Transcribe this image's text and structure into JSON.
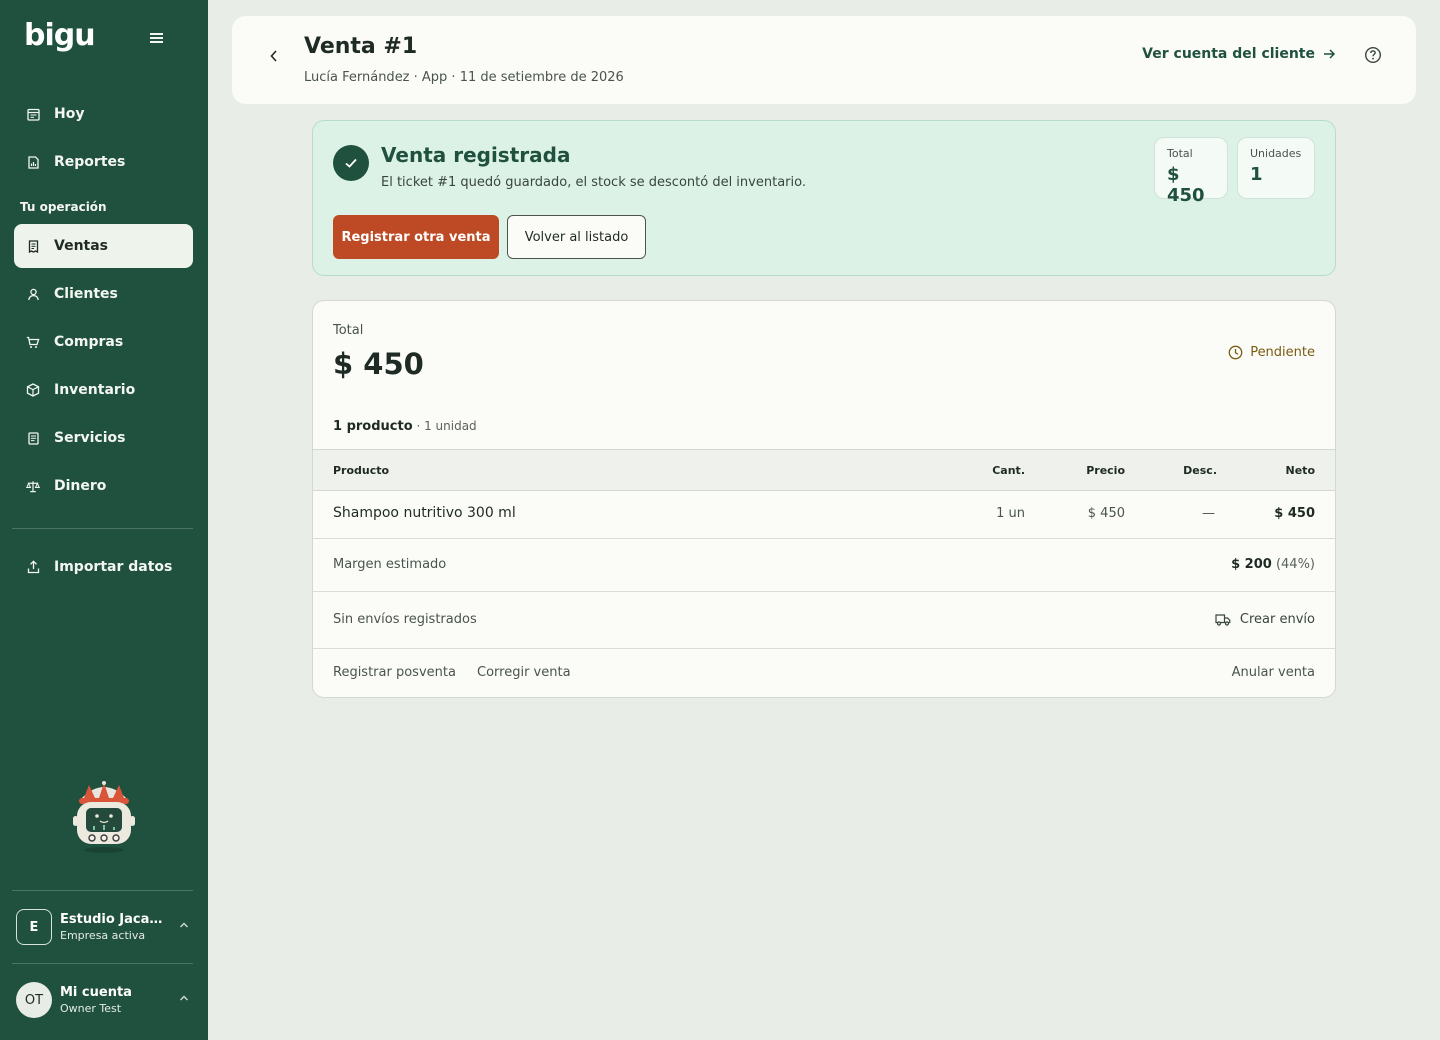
{
  "app": {
    "logo_text": "bigu"
  },
  "sidebar": {
    "top_items": [
      {
        "label": "Hoy",
        "icon": "calendar-icon"
      },
      {
        "label": "Reportes",
        "icon": "report-icon"
      }
    ],
    "section_label": "Tu operación",
    "ops_items": [
      {
        "label": "Ventas",
        "icon": "receipt-icon",
        "active": true
      },
      {
        "label": "Clientes",
        "icon": "user-icon"
      },
      {
        "label": "Compras",
        "icon": "cart-icon"
      },
      {
        "label": "Inventario",
        "icon": "box-icon"
      },
      {
        "label": "Servicios",
        "icon": "document-icon"
      },
      {
        "label": "Dinero",
        "icon": "scale-icon"
      }
    ],
    "import_item": {
      "label": "Importar datos",
      "icon": "upload-icon"
    },
    "company": {
      "initial": "E",
      "name": "Estudio Jacara...",
      "subtitle": "Empresa activa"
    },
    "account": {
      "initials": "OT",
      "name": "Mi cuenta",
      "subtitle": "Owner Test"
    }
  },
  "header": {
    "title": "Venta #1",
    "subtitle": "Lucía Fernández · App · 11 de setiembre de 2026",
    "client_link": "Ver cuenta del cliente"
  },
  "success": {
    "title": "Venta registrada",
    "description": "El ticket #1 quedó guardado, el stock se descontó del inventario.",
    "primary_button": "Registrar otra venta",
    "secondary_button": "Volver al listado",
    "stats": [
      {
        "label": "Total",
        "value": "$ 450"
      },
      {
        "label": "Unidades",
        "value": "1"
      }
    ]
  },
  "detail": {
    "total_label": "Total",
    "total_value": "$ 450",
    "status": "Pendiente",
    "summary_bold": "1 producto",
    "summary_rest": " · 1 unidad",
    "columns": {
      "product": "Producto",
      "qty": "Cant.",
      "price": "Precio",
      "discount": "Desc.",
      "net": "Neto"
    },
    "items": [
      {
        "product": "Shampoo nutritivo 300 ml",
        "qty": "1 un",
        "price": "$ 450",
        "discount": "—",
        "net": "$ 450"
      }
    ],
    "margin_label": "Margen estimado",
    "margin_value": "$ 200",
    "margin_pct": "(44%)",
    "shipping_label": "Sin envíos registrados",
    "shipping_action": "Crear envío",
    "actions": {
      "post_sale": "Registrar posventa",
      "correct": "Corregir venta",
      "cancel": "Anular venta"
    }
  },
  "colors": {
    "sidebar": "#20513f",
    "accent": "#bd4a24",
    "success_bg": "#ddf2e6",
    "pending": "#7a5b12"
  }
}
